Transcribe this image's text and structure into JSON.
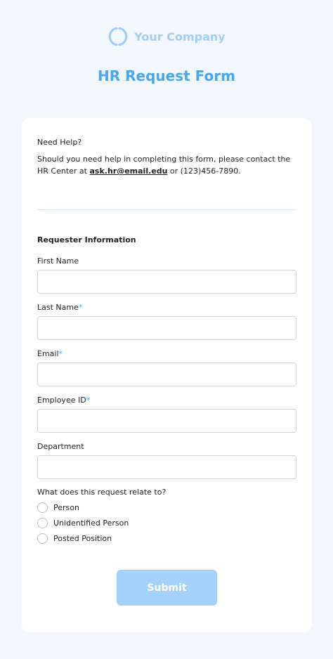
{
  "brand": {
    "name": "Your Company",
    "logo_icon": "ring-logo-icon",
    "color": "#a2cdf6"
  },
  "header": {
    "title": "HR Request Form",
    "title_color": "#4aa6ef"
  },
  "help": {
    "title": "Need Help?",
    "text_before": "Should you need help in completing this form, please contact the HR Center at ",
    "email": "ask.hr@email.edu",
    "text_after": " or (123)456-7890."
  },
  "form": {
    "section_title": "Requester Information",
    "fields": [
      {
        "label": "First Name",
        "required": false,
        "value": "",
        "placeholder": ""
      },
      {
        "label": "Last Name",
        "required": true,
        "value": "",
        "placeholder": ""
      },
      {
        "label": "Email",
        "required": true,
        "value": "",
        "placeholder": ""
      },
      {
        "label": "Employee ID",
        "required": true,
        "value": "",
        "placeholder": ""
      },
      {
        "label": "Department",
        "required": false,
        "value": "",
        "placeholder": ""
      }
    ],
    "required_marker": "*",
    "question": "What does this request relate to?",
    "options": [
      {
        "label": "Person",
        "selected": false
      },
      {
        "label": "Unidentified Person",
        "selected": false
      },
      {
        "label": "Posted Position",
        "selected": false
      }
    ],
    "submit_label": "Submit",
    "accent_color": "#4aa6ef",
    "button_color": "#a2d1fa"
  }
}
